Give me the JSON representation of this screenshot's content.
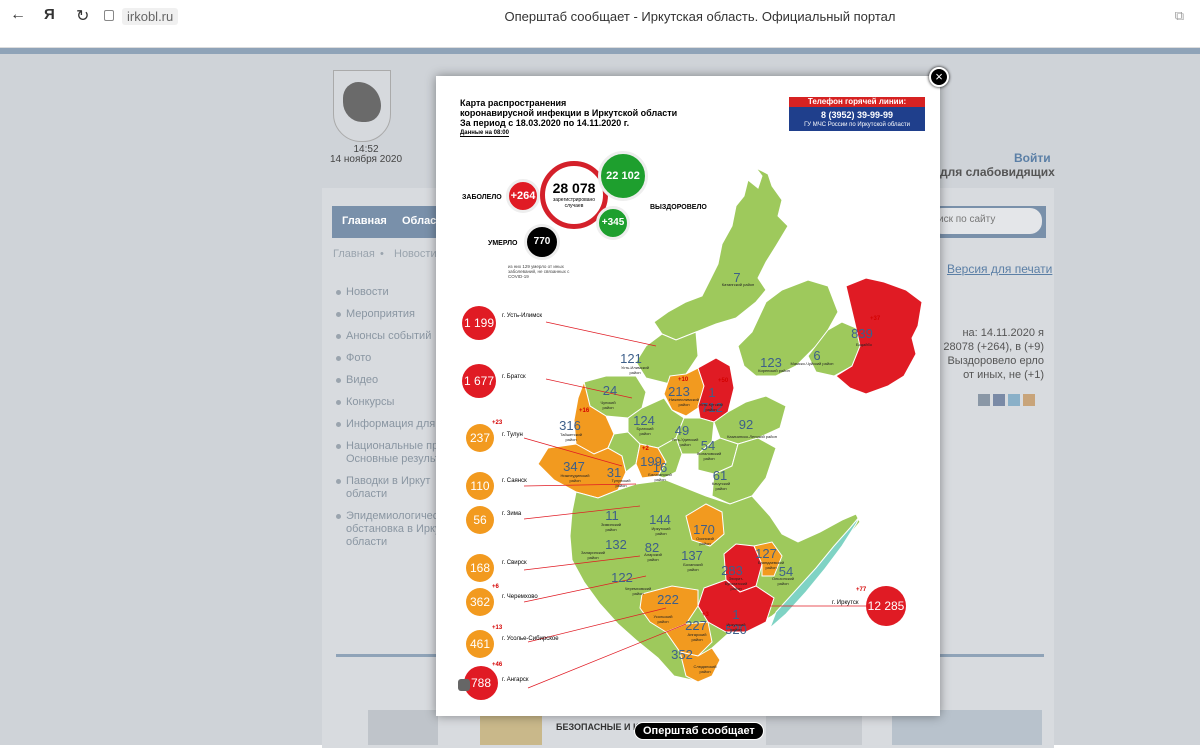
{
  "browser": {
    "back_glyph": "←",
    "yandex_glyph": "Я",
    "reload_glyph": "↻",
    "domain": "irkobl.ru",
    "tab_title": "Оперштаб сообщает - Иркутская область. Официальный портал"
  },
  "site": {
    "time": "14:52",
    "date": "14 ноября 2020",
    "login": "Войти",
    "vision": "для слабовидящих",
    "menu": [
      "Главная",
      "Област"
    ],
    "search_placeholder": "иск по сайту",
    "breadcrumb": [
      "Главная",
      "•",
      "Новости"
    ],
    "print_link": "Версия для печати",
    "sidebar": [
      "Новости",
      "Мероприятия",
      "Анонсы событий",
      "Фото",
      "Видео",
      "Конкурсы",
      "Информация для",
      "Национальные пр Основные результ",
      "Паводки в Иркут области",
      "Эпидемиологичес обстановка в Ирку области"
    ],
    "article_snippet": "на: 14.11.2020 я 28078 (+264), в (+9) Выздоровело ерло от иных, не (+1)",
    "banner_text": "БЕЗОПАСНЫЕ И КАЧЕСТВЕННЫЕ",
    "caption": "Оперштаб сообщает"
  },
  "map": {
    "title_lines": [
      "Карта распространения",
      "коронавирусной инфекции в Иркутской области",
      "За период с 18.03.2020 по 14.11.2020 г."
    ],
    "note": "Данные на 08:00",
    "hotline": {
      "title": "Телефон горячей линии:",
      "phone": "8 (3952) 39-99-99",
      "org": "ГУ МЧС России по Иркутской области"
    },
    "totals": {
      "sick_label": "ЗАБОЛЕЛО",
      "sick_delta": "+264",
      "total": "28 078",
      "total_caption": "зарегистрировано случаев",
      "recovered": "22 102",
      "recovered_delta": "+345",
      "recovered_label": "ВЫЗДОРОВЕЛО",
      "died_label": "УМЕРЛО",
      "died": "770",
      "died_note": "из них 129 умерло от иных заболеваний, не связанных с COVID-19"
    },
    "cities": [
      {
        "value": "1 199",
        "label": "г. Усть-Илимск",
        "delta": "",
        "color": "#e01b24"
      },
      {
        "value": "1 677",
        "label": "г. Братск",
        "delta": "",
        "color": "#e01b24"
      },
      {
        "value": "237",
        "label": "г. Тулун",
        "delta": "+23",
        "color": "#f29a1f"
      },
      {
        "value": "110",
        "label": "г. Саянск",
        "delta": "",
        "color": "#f29a1f"
      },
      {
        "value": "56",
        "label": "г. Зима",
        "delta": "",
        "color": "#f29a1f"
      },
      {
        "value": "168",
        "label": "г. Свирск",
        "delta": "",
        "color": "#f29a1f"
      },
      {
        "value": "362",
        "label": "г. Черемхово",
        "delta": "+6",
        "color": "#f29a1f"
      },
      {
        "value": "461",
        "label": "г. Усолье-Сибирское",
        "delta": "+13",
        "color": "#f29a1f"
      },
      {
        "value": "788",
        "label": "г. Ангарск",
        "delta": "+46",
        "color": "#e01b24"
      },
      {
        "value": "12 285",
        "label": "г. Иркутск",
        "delta": "+77",
        "color": "#e01b24"
      }
    ],
    "regions": [
      {
        "value": "7",
        "name": "Катангский район"
      },
      {
        "value": "839",
        "name": "Бодайбо",
        "delta": "+37"
      },
      {
        "value": "6",
        "name": "Мамско-Чуйский район"
      },
      {
        "value": "123",
        "name": "Киренский район"
      },
      {
        "value": "121",
        "name": "Усть-Илимский район"
      },
      {
        "value": "213",
        "name": "Нижнеилимский район",
        "delta": "+10"
      },
      {
        "value": "1 712",
        "name": "Усть-Кутский район",
        "delta": "+50"
      },
      {
        "value": "24",
        "name": "Чунский район"
      },
      {
        "value": "124",
        "name": "Братский район"
      },
      {
        "value": "316",
        "name": "Тайшетский район",
        "delta": "+16"
      },
      {
        "value": "49",
        "name": "Усть-Удинский район"
      },
      {
        "value": "92",
        "name": "Казачинско-Ленский район"
      },
      {
        "value": "54",
        "name": "Жигаловский район"
      },
      {
        "value": "347",
        "name": "Нижнеудинский район"
      },
      {
        "value": "199",
        "name": ""
      },
      {
        "value": "31",
        "name": "Тулунский район"
      },
      {
        "value": "16",
        "name": "Балаганский район"
      },
      {
        "value": "61",
        "name": "Качугский район"
      },
      {
        "value": "11",
        "name": "Зиминский район"
      },
      {
        "value": "144",
        "name": "Иркутский район"
      },
      {
        "value": "170",
        "name": "Осинский район"
      },
      {
        "value": "132",
        "name": "Заларинский район"
      },
      {
        "value": "82",
        "name": "Аларский район"
      },
      {
        "value": "137",
        "name": "Боханский район"
      },
      {
        "value": "127",
        "name": "Баяндаевский район"
      },
      {
        "value": "122",
        "name": "Черемховский район"
      },
      {
        "value": "283",
        "name": "Эхирит-Булагатский район"
      },
      {
        "value": "54",
        "name": "Ольхонский район"
      },
      {
        "value": "222",
        "name": "Усольский район"
      },
      {
        "value": "227",
        "name": "Ангарский район"
      },
      {
        "value": "1 520",
        "name": "Иркутский район"
      },
      {
        "value": "352",
        "name": "Слюдянский район"
      }
    ],
    "region_delta_extra": [
      "+2",
      "+3"
    ]
  },
  "colors": {
    "red": "#e01b24",
    "orange": "#f29a1f",
    "green": "#9ec95c",
    "hotline_blue": "#1f3f8c"
  }
}
